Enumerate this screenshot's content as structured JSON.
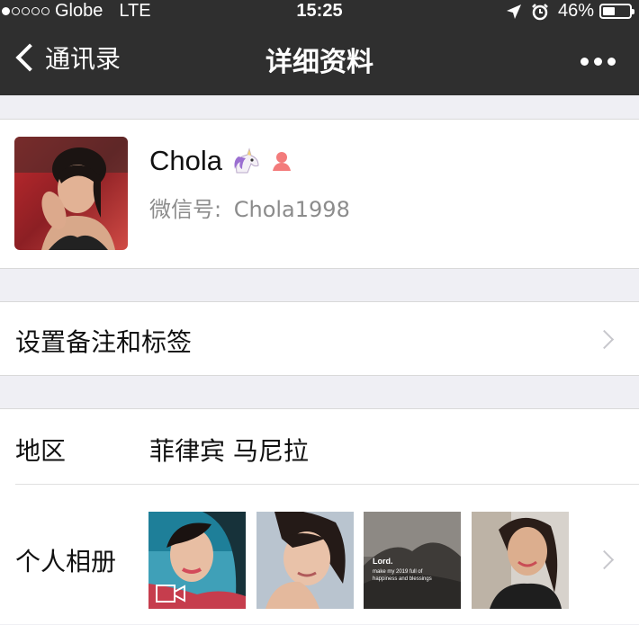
{
  "status_bar": {
    "carrier": "Globe",
    "network": "LTE",
    "time": "15:25",
    "battery": "46%",
    "battery_level": 0.46,
    "signal_bars_filled": 1,
    "signal_bars_total": 5
  },
  "nav": {
    "back_label": "通讯录",
    "title": "详细资料"
  },
  "profile": {
    "name": "Chola",
    "wechat_id_label": "微信号:",
    "wechat_id": "Chola1998"
  },
  "remark": {
    "label": "设置备注和标签"
  },
  "region": {
    "label": "地区",
    "value": "菲律宾 马尼拉"
  },
  "album": {
    "label": "个人相册",
    "quote_title": "Lord.",
    "quote_line1": "make my 2019 full of",
    "quote_line2": "happiness and blessings"
  },
  "colors": {
    "nav_bg": "#2f2f2f",
    "page_bg": "#efeff4",
    "card_bg": "#ffffff",
    "secondary_text": "#8c8c8c",
    "female_icon": "#f37b7b"
  },
  "icons": [
    "back-chevron-icon",
    "more-icon",
    "unicorn-emoji-icon",
    "female-icon",
    "chevron-right-icon",
    "video-icon",
    "location-arrow-icon",
    "alarm-icon",
    "battery-icon"
  ]
}
